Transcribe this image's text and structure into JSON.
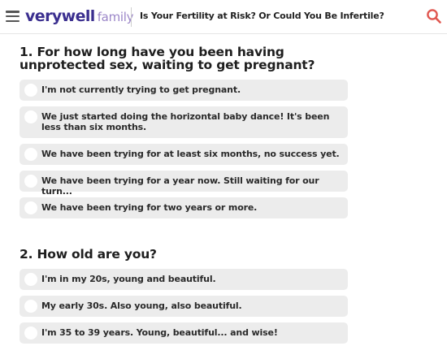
{
  "header": {
    "logo_primary": "verywell",
    "logo_secondary": "family",
    "title": "Is Your Fertility at Risk? Or Could You Be Infertile?",
    "icons": {
      "menu": "hamburger-menu-icon",
      "search": "search-icon"
    },
    "colors": {
      "logo_primary": "#3b2f8f",
      "logo_secondary": "#9b86c8",
      "search": "#e0564f"
    }
  },
  "questions": [
    {
      "title": "1. For how long have you been having unprotected sex, waiting to get pregnant?",
      "options": [
        "I'm not currently trying to get pregnant.",
        "We just started doing the horizontal baby dance! It's been less than six months.",
        "We have been trying for at least six months, no success yet.",
        "We have been trying for a year now. Still waiting for our turn...",
        "We have been trying for two years or more."
      ]
    },
    {
      "title": "2. How old are you?",
      "options": [
        "I'm in my 20s, young and beautiful.",
        "My early 30s. Also young, also beautiful.",
        "I'm 35 to 39 years. Young, beautiful... and wise!"
      ]
    }
  ]
}
